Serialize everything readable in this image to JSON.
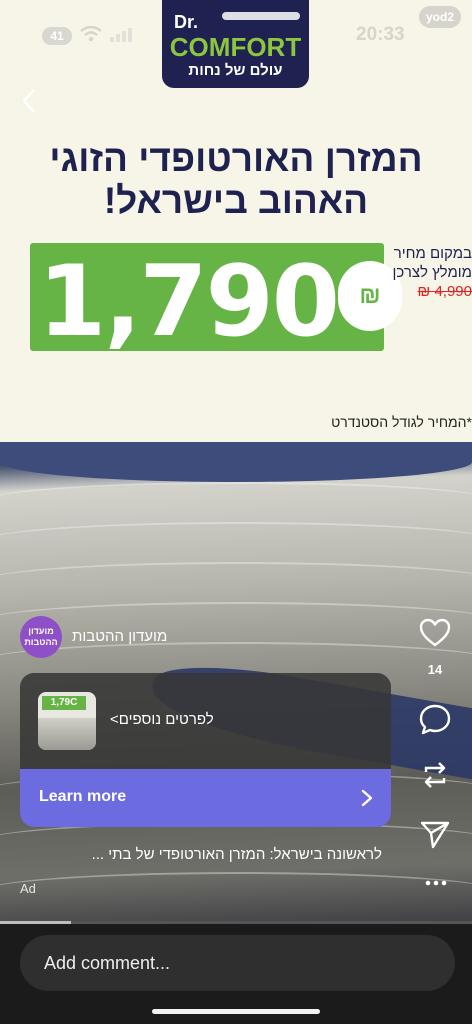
{
  "status_bar": {
    "signal_badge": "41",
    "time": "20:33",
    "source_logo": "yod2"
  },
  "ad": {
    "brand": {
      "prefix": "Dr.",
      "name": "COMFORT",
      "tagline": "עולם של נחות"
    },
    "headline": "המזרן האורטופדי הזוגי האהוב בישראל!",
    "price": {
      "amount": "1,790",
      "currency": "₪",
      "compare_label": "במקום מחיר מומלץ לצרכן",
      "old_price": "4,990 ₪"
    },
    "footnote": "*המחיר לגודל הסטנדרט"
  },
  "post": {
    "page_name": "מועדון ההטבות",
    "page_avatar_text": "מועדון ההטבות",
    "like_count": "14",
    "cta_card": {
      "thumb_price": "1,79C",
      "text": "לפרטים נוספים>",
      "button_label": "Learn more"
    },
    "caption": "לראשונה בישראל: המזרן האורטופדי של בתי ...",
    "ad_label": "Ad",
    "progress": 0.15
  },
  "comment_bar": {
    "placeholder": "Add comment..."
  },
  "icons": {
    "back": "chevron-left-icon",
    "like": "heart-icon",
    "comment": "comment-bubble-icon",
    "share_repost": "repost-icon",
    "send": "paper-plane-icon",
    "more": "ellipsis-icon",
    "learn_more_arrow": "chevron-right-icon"
  },
  "colors": {
    "brand_navy": "#1f2150",
    "brand_green": "#66b346",
    "cta_purple": "#6c6be0",
    "old_price_red": "#dd2222"
  }
}
